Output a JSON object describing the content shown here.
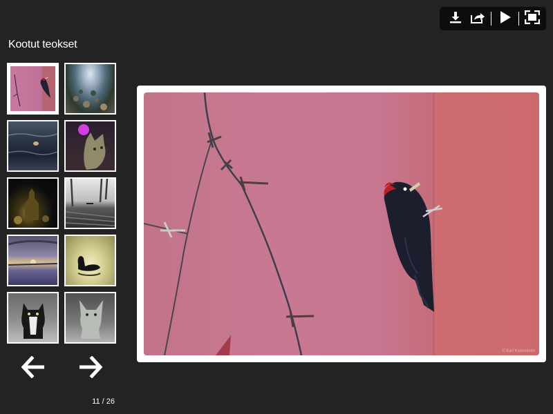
{
  "toolbar": {
    "buttons": [
      {
        "name": "download",
        "icon": "download-icon"
      },
      {
        "name": "share",
        "icon": "share-icon"
      },
      {
        "name": "slideshow",
        "icon": "play-icon"
      },
      {
        "name": "fullscreen",
        "icon": "fullscreen-icon"
      }
    ]
  },
  "gallery": {
    "title": "Kootut teokset",
    "current_index": 11,
    "total": 26,
    "counter_text": "11 / 26",
    "thumbnails": [
      {
        "subject": "woodpecker on pink wall",
        "active": true
      },
      {
        "subject": "frozen lake with rocks",
        "active": false
      },
      {
        "subject": "swimmer in sea",
        "active": false
      },
      {
        "subject": "cat with purple light",
        "active": false
      },
      {
        "subject": "church at night",
        "active": false
      },
      {
        "subject": "snowy park path",
        "active": false
      },
      {
        "subject": "sunset over snow",
        "active": false
      },
      {
        "subject": "swan silhouette",
        "active": false
      },
      {
        "subject": "black and white cat",
        "active": false
      },
      {
        "subject": "grey sphynx cat",
        "active": false
      }
    ]
  },
  "navigation": {
    "prev_icon": "arrow-left-icon",
    "next_icon": "arrow-right-icon"
  },
  "main_image": {
    "subject": "black woodpecker clinging to pink wall beside barbed wire",
    "caption": "© Kari Koivuniemi"
  },
  "colors": {
    "background": "#232323",
    "toolbar": "#0d0d0d",
    "frame": "#ffffff",
    "wall": "#c87992"
  }
}
